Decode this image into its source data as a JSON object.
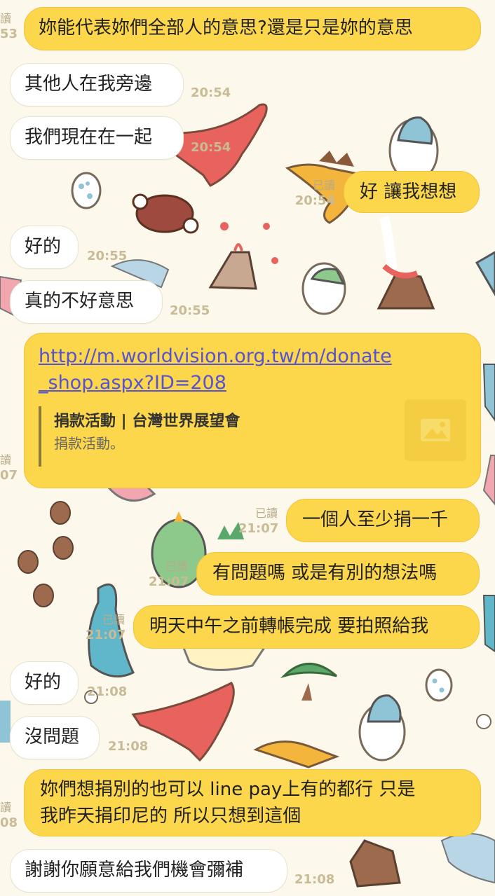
{
  "messages": [
    {
      "dir": "out",
      "text": "妳能代表妳們全部人的意思?還是只是妳的意思",
      "time": "",
      "read": "讀"
    },
    {
      "dir": "in",
      "text": "其他人在我旁邊",
      "time": "20:54"
    },
    {
      "dir": "in",
      "text": "我們現在在一起",
      "time": "20:54"
    },
    {
      "dir": "out",
      "text": "好 讓我想想",
      "time": "20:54",
      "read": "已讀"
    },
    {
      "dir": "in",
      "text": "好的",
      "time": "20:55"
    },
    {
      "dir": "in",
      "text": "真的不好意思",
      "time": "20:55"
    },
    {
      "dir": "link",
      "url": "http://m.worldvision.org.tw/m/donate_shop.aspx?ID=208",
      "url_line1": "http://m.worldvision.org.tw/m/donate",
      "url_line2": "_shop.aspx?ID=208",
      "preview_title": "捐款活動 | 台灣世界展望會",
      "preview_sub": "捐款活動。",
      "time": "07",
      "read": "讀"
    },
    {
      "dir": "out",
      "text": "一個人至少捐一千",
      "time": "21:07",
      "read": "已讀"
    },
    {
      "dir": "out",
      "text": "有問題嗎 或是有別的想法嗎",
      "time": "21:07",
      "read": "已讀"
    },
    {
      "dir": "out",
      "text": "明天中午之前轉帳完成 要拍照給我",
      "time": "21:07",
      "read": "已讀"
    },
    {
      "dir": "in",
      "text": "好的",
      "time": "21:08"
    },
    {
      "dir": "in",
      "text": "沒問題",
      "time": "21:08"
    },
    {
      "dir": "out2",
      "line1": "妳們想捐別的也可以 line pay上有的都行 只是",
      "line2": "我昨天捐印尼的 所以只想到這個",
      "time": "08",
      "read": "讀"
    },
    {
      "dir": "in",
      "text": "謝謝你願意給我們機會彌補",
      "time": "21:08"
    }
  ],
  "top_meta": {
    "read": "讀",
    "time": "53"
  },
  "colors": {
    "bubble_out": "#fcd64b",
    "bubble_in": "#ffffff",
    "background": "#fcf8ec",
    "link": "#5553d2"
  }
}
